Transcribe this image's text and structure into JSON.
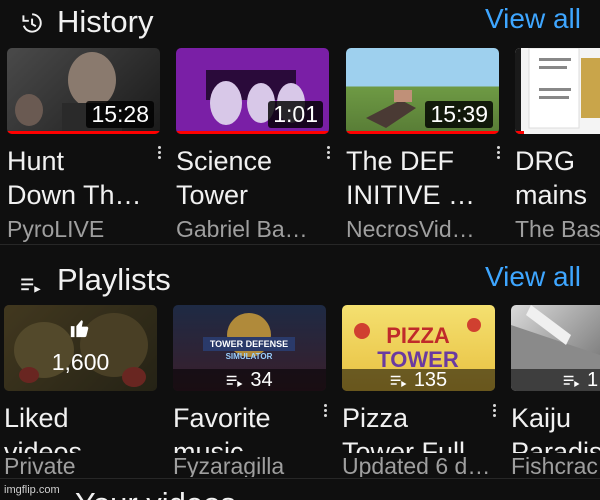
{
  "history": {
    "title": "History",
    "view_all": "View all",
    "icon": "history-icon",
    "items": [
      {
        "title_line1": "Hunt",
        "title_line2": "Down Th…",
        "channel": "PyroLIVE",
        "duration": "15:28",
        "thumb_colors": [
          "#3a3a3a",
          "#1c1c1c"
        ],
        "watched_fraction": 1.0
      },
      {
        "title_line1": "Science",
        "title_line2": "Tower",
        "channel": "Gabriel Ba…",
        "duration": "1:01",
        "thumb_colors": [
          "#7a1fa6",
          "#4c0f70"
        ],
        "watched_fraction": 1.0
      },
      {
        "title_line1": "The DEF",
        "title_line2": "INITIVE …",
        "channel": "NecrosVid…",
        "duration": "15:39",
        "thumb_colors": [
          "#8fc6e6",
          "#6f9a44"
        ],
        "watched_fraction": 1.0
      },
      {
        "title_line1": "DRG",
        "title_line2": "mains",
        "channel": "The Bas",
        "duration": "",
        "thumb_colors": [
          "#f4f4f4",
          "#c9a54a"
        ],
        "watched_fraction": 0.1
      }
    ]
  },
  "playlists": {
    "title": "Playlists",
    "view_all": "View all",
    "icon": "playlist-icon",
    "items": [
      {
        "title_line1": "Liked",
        "title_line2": "videos",
        "subtitle": "Private",
        "count": "1,600",
        "type": "liked",
        "thumb_colors": [
          "#7b6a3c",
          "#a5504a"
        ]
      },
      {
        "title_line1": "Favorite",
        "title_line2": "music",
        "subtitle": "Fyzaragilla",
        "count": "34",
        "type": "playlist",
        "thumb_colors": [
          "#2a2f4a",
          "#6a2a2a"
        ]
      },
      {
        "title_line1": "Pizza",
        "title_line2": "Tower Full…",
        "subtitle": "Updated 6 d…",
        "count": "135",
        "type": "playlist",
        "thumb_colors": [
          "#f0d060",
          "#5a3a8a"
        ]
      },
      {
        "title_line1": "Kaiju",
        "title_line2": "Paradise",
        "subtitle": "Fishcrac",
        "count": "1",
        "type": "playlist",
        "thumb_colors": [
          "#cfcfcf",
          "#5a5a5a"
        ]
      }
    ]
  },
  "next_section": {
    "title": "Your videos"
  },
  "watermark": "imgflip.com",
  "colors": {
    "background": "#0f0f0f",
    "link": "#3ea6ff",
    "progress": "#ff0000",
    "secondary_text": "#9f9f9f"
  }
}
